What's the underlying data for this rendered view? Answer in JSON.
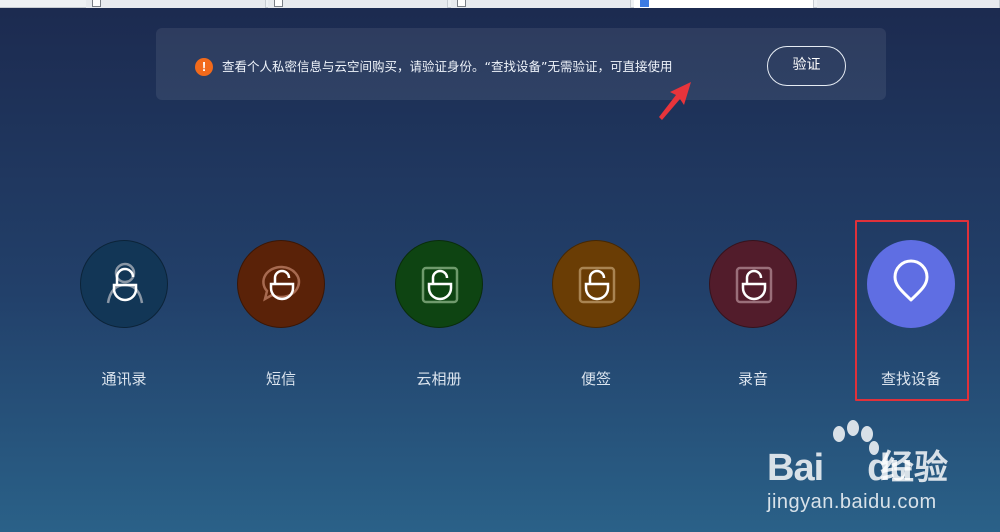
{
  "notice": {
    "text": "查看个人私密信息与云空间购买，请验证身份。“查找设备”无需验证，可直接使用",
    "verify_label": "验证"
  },
  "features": [
    {
      "label": "通讯录",
      "color": "#123656",
      "icon": "contacts-lock-icon"
    },
    {
      "label": "短信",
      "color": "#5a2208",
      "icon": "message-lock-icon"
    },
    {
      "label": "云相册",
      "color": "#0e4412",
      "icon": "gallery-lock-icon"
    },
    {
      "label": "便签",
      "color": "#6a3d05",
      "icon": "notes-lock-icon"
    },
    {
      "label": "录音",
      "color": "#521c2b",
      "icon": "recorder-lock-icon"
    },
    {
      "label": "查找设备",
      "color": "#5f6ee3",
      "icon": "location-pin-icon"
    }
  ],
  "watermark": {
    "brand": "Bai",
    "brand_tail": "du",
    "cn": "经验",
    "url": "jingyan.baidu.com"
  },
  "colors": {
    "highlight": "#e0313a",
    "warning": "#f26a1b",
    "find_device": "#5f6ee3"
  }
}
